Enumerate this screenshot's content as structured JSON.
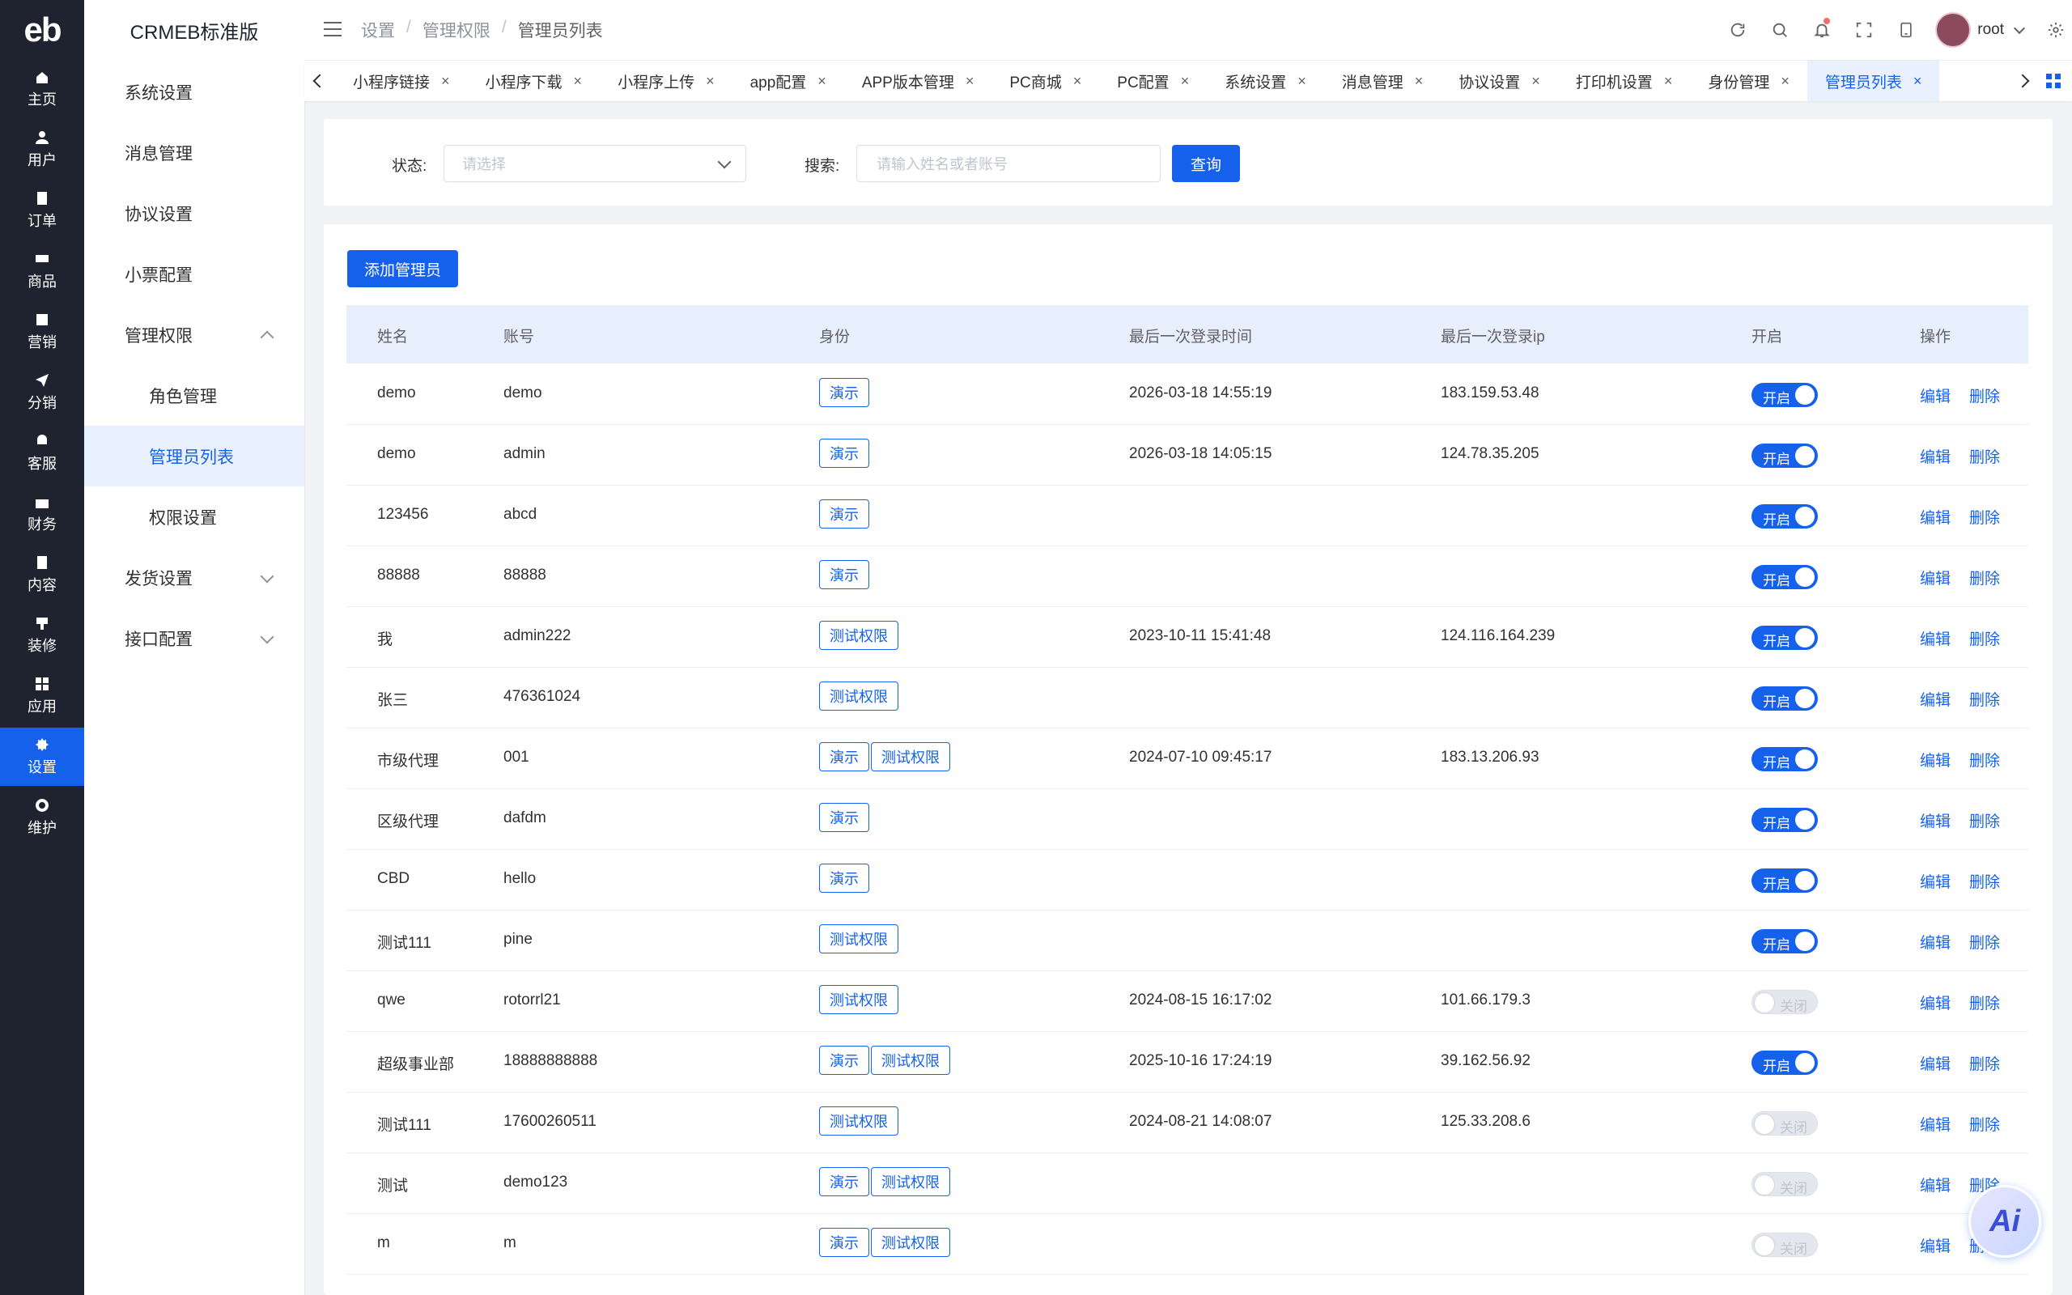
{
  "app": {
    "logo_text": "eb",
    "name": "CRMEB标准版"
  },
  "rail": [
    {
      "label": "主页",
      "icon": "home-icon"
    },
    {
      "label": "用户",
      "icon": "user-icon"
    },
    {
      "label": "订单",
      "icon": "order-icon"
    },
    {
      "label": "商品",
      "icon": "product-icon"
    },
    {
      "label": "营销",
      "icon": "marketing-icon"
    },
    {
      "label": "分销",
      "icon": "distribution-icon"
    },
    {
      "label": "客服",
      "icon": "service-icon"
    },
    {
      "label": "财务",
      "icon": "finance-icon"
    },
    {
      "label": "内容",
      "icon": "content-icon"
    },
    {
      "label": "装修",
      "icon": "decoration-icon"
    },
    {
      "label": "应用",
      "icon": "apps-icon"
    },
    {
      "label": "设置",
      "icon": "settings-icon",
      "active": true
    },
    {
      "label": "维护",
      "icon": "maintenance-icon"
    }
  ],
  "submenu": {
    "items": [
      {
        "label": "系统设置"
      },
      {
        "label": "消息管理"
      },
      {
        "label": "协议设置"
      },
      {
        "label": "小票配置"
      },
      {
        "label": "管理权限"
      },
      {
        "label": "角色管理"
      },
      {
        "label": "管理员列表"
      },
      {
        "label": "权限设置"
      },
      {
        "label": "发货设置"
      },
      {
        "label": "接口配置"
      }
    ]
  },
  "breadcrumb": [
    "设置",
    "管理权限",
    "管理员列表"
  ],
  "breadcrumb_sep": "/",
  "header": {
    "username": "root",
    "icons": [
      "refresh-icon",
      "search-icon",
      "bell-icon",
      "fullscreen-icon",
      "tablet-icon",
      "gear-icon"
    ]
  },
  "tabs": [
    {
      "label": "小程序链接"
    },
    {
      "label": "小程序下载"
    },
    {
      "label": "小程序上传"
    },
    {
      "label": "app配置"
    },
    {
      "label": "APP版本管理"
    },
    {
      "label": "PC商城"
    },
    {
      "label": "PC配置"
    },
    {
      "label": "系统设置"
    },
    {
      "label": "消息管理"
    },
    {
      "label": "协议设置"
    },
    {
      "label": "打印机设置"
    },
    {
      "label": "身份管理"
    },
    {
      "label": "管理员列表",
      "active": true
    }
  ],
  "tab_close": "×",
  "filter": {
    "status_label": "状态:",
    "status_placeholder": "请选择",
    "search_label": "搜索:",
    "search_placeholder": "请输入姓名或者账号",
    "query_button": "查询"
  },
  "add_button": "添加管理员",
  "table": {
    "columns": [
      "姓名",
      "账号",
      "身份",
      "最后一次登录时间",
      "最后一次登录ip",
      "开启",
      "操作"
    ],
    "switch_on": "开启",
    "switch_off": "关闭",
    "edit": "编辑",
    "delete": "删除",
    "rows": [
      {
        "name": "demo",
        "account": "demo",
        "roles": [
          "演示"
        ],
        "last_time": "2026-03-18 14:55:19",
        "last_ip": "183.159.53.48",
        "enabled": true
      },
      {
        "name": "demo",
        "account": "admin",
        "roles": [
          "演示"
        ],
        "last_time": "2026-03-18 14:05:15",
        "last_ip": "124.78.35.205",
        "enabled": true
      },
      {
        "name": "123456",
        "account": "abcd",
        "roles": [
          "演示"
        ],
        "last_time": "",
        "last_ip": "",
        "enabled": true
      },
      {
        "name": "88888",
        "account": "88888",
        "roles": [
          "演示"
        ],
        "last_time": "",
        "last_ip": "",
        "enabled": true
      },
      {
        "name": "我",
        "account": "admin222",
        "roles": [
          "测试权限"
        ],
        "last_time": "2023-10-11 15:41:48",
        "last_ip": "124.116.164.239",
        "enabled": true
      },
      {
        "name": "张三",
        "account": "476361024",
        "roles": [
          "测试权限"
        ],
        "last_time": "",
        "last_ip": "",
        "enabled": true
      },
      {
        "name": "市级代理",
        "account": "001",
        "roles": [
          "演示",
          "测试权限"
        ],
        "last_time": "2024-07-10 09:45:17",
        "last_ip": "183.13.206.93",
        "enabled": true
      },
      {
        "name": "区级代理",
        "account": "dafdm",
        "roles": [
          "演示"
        ],
        "last_time": "",
        "last_ip": "",
        "enabled": true
      },
      {
        "name": "CBD",
        "account": "hello",
        "roles": [
          "演示"
        ],
        "last_time": "",
        "last_ip": "",
        "enabled": true
      },
      {
        "name": "测试111",
        "account": "pine",
        "roles": [
          "测试权限"
        ],
        "last_time": "",
        "last_ip": "",
        "enabled": true
      },
      {
        "name": "qwe",
        "account": "rotorrl21",
        "roles": [
          "测试权限"
        ],
        "last_time": "2024-08-15 16:17:02",
        "last_ip": "101.66.179.3",
        "enabled": false
      },
      {
        "name": "超级事业部",
        "account": "18888888888",
        "roles": [
          "演示",
          "测试权限"
        ],
        "last_time": "2025-10-16 17:24:19",
        "last_ip": "39.162.56.92",
        "enabled": true
      },
      {
        "name": "测试111",
        "account": "17600260511",
        "roles": [
          "测试权限"
        ],
        "last_time": "2024-08-21 14:08:07",
        "last_ip": "125.33.208.6",
        "enabled": false
      },
      {
        "name": "测试",
        "account": "demo123",
        "roles": [
          "演示",
          "测试权限"
        ],
        "last_time": "",
        "last_ip": "",
        "enabled": false
      },
      {
        "name": "m",
        "account": "m",
        "roles": [
          "演示",
          "测试权限"
        ],
        "last_time": "",
        "last_ip": "",
        "enabled": false
      }
    ]
  },
  "ai_button": "Ai",
  "colors": {
    "primary": "#1561ec",
    "rail_bg": "#1f2330",
    "active_bg": "#eaf1fe"
  }
}
